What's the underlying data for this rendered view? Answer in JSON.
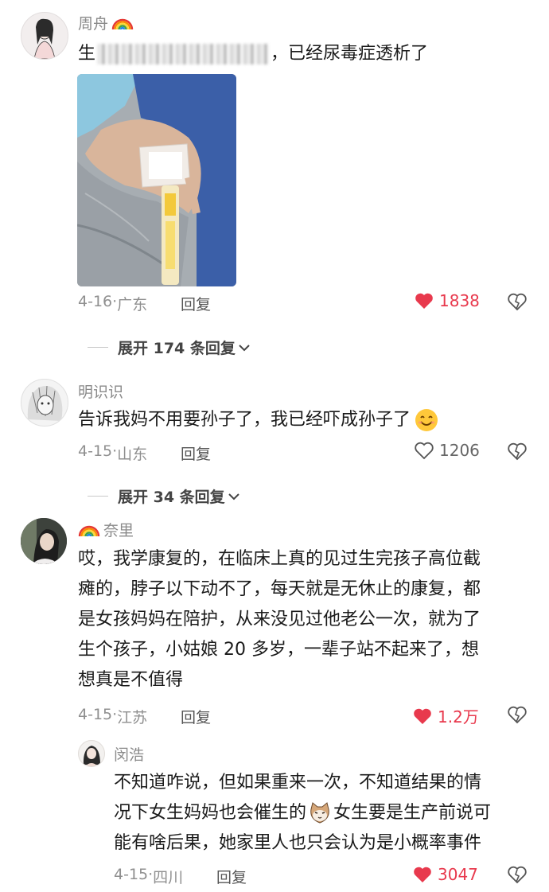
{
  "comments": [
    {
      "author": "周舟",
      "text_visible_start": "生",
      "text_visible_end": "，已经尿毒症透析了",
      "date": "4-16",
      "region": "广东",
      "reply_label": "回复",
      "likes": "1838",
      "liked": true,
      "expand_label": "展开 174 条回复"
    },
    {
      "author": "明识识",
      "text": "告诉我妈不用要孙子了，我已经吓成孙子了",
      "date": "4-15",
      "region": "山东",
      "reply_label": "回复",
      "likes": "1206",
      "liked": false,
      "expand_label": "展开 34 条回复"
    },
    {
      "author": "奈里",
      "lines": [
        "哎，我学康复的，在临床上真的见过生完孩子高位截",
        "瘫的，脖子以下动不了，每天就是无休止的康复，都",
        "是女孩妈妈在陪护，从来没见过他老公一次，就为了",
        "生个孩子，小姑娘 20 多岁，一辈子站不起来了，想",
        "想真是不值得"
      ],
      "date": "4-15",
      "region": "江苏",
      "reply_label": "回复",
      "likes": "1.2万",
      "liked": true
    },
    {
      "author": "闵浩",
      "lines": [
        "不知道咋说，但如果重来一次，不知道结果的情",
        "况下女生妈妈也会催生的",
        "女生要是生产前说可",
        "能有啥后果，她家里人也只会认为是小概率事件"
      ],
      "date": "4-15",
      "region": "四川",
      "reply_label": "回复",
      "likes": "3047",
      "liked": true
    }
  ],
  "colors": {
    "heart_red": "#e8394d",
    "meta_gray": "#8f8f8f"
  },
  "icons": [
    "heart-icon",
    "dislike-heart-icon",
    "chevron-down-icon",
    "rainbow-icon",
    "smile-emoji-icon",
    "cat-emoji-icon"
  ]
}
